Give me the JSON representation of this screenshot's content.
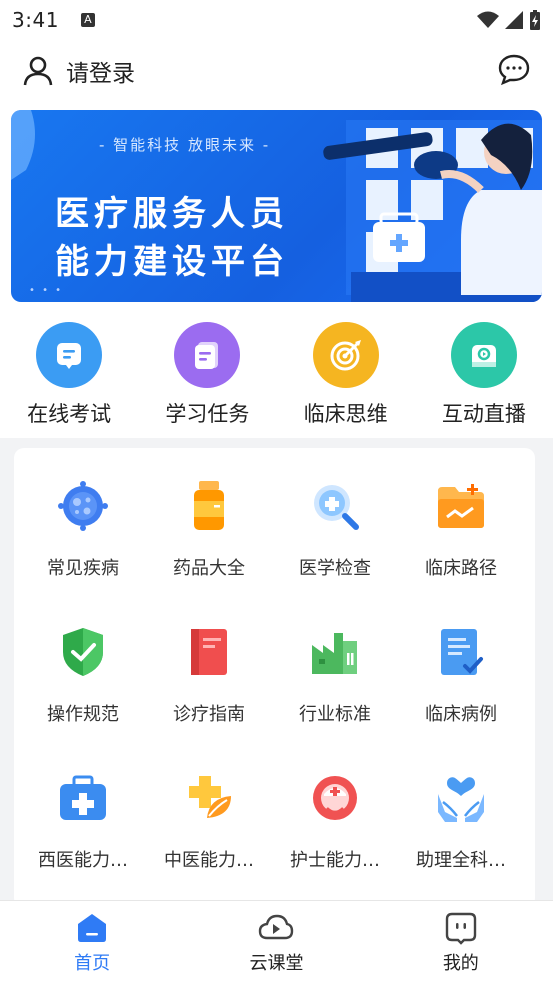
{
  "status_bar": {
    "time": "3:41",
    "icons": [
      "notification-a-icon",
      "wifi-icon",
      "signal-icon",
      "battery-charging-icon"
    ]
  },
  "header": {
    "login_label": "请登录",
    "icons": [
      "user-icon",
      "chat-icon"
    ]
  },
  "banner": {
    "slogan": "- 智能科技 放眼未来 -",
    "title_line1": "医疗服务人员",
    "title_line2": "能力建设平台",
    "indicator": "• • •"
  },
  "quick_menu": [
    {
      "label": "在线考试",
      "icon": "exam-icon",
      "color": "#3b9cf3"
    },
    {
      "label": "学习任务",
      "icon": "task-icon",
      "color": "#9b6cf0"
    },
    {
      "label": "临床思维",
      "icon": "target-icon",
      "color": "#f5b521"
    },
    {
      "label": "互动直播",
      "icon": "live-icon",
      "color": "#2cc7a8"
    }
  ],
  "grid": [
    {
      "label": "常见疾病",
      "icon": "virus-icon"
    },
    {
      "label": "药品大全",
      "icon": "medicine-bottle-icon"
    },
    {
      "label": "医学检查",
      "icon": "magnifier-icon"
    },
    {
      "label": "临床路径",
      "icon": "folder-icon"
    },
    {
      "label": "操作规范",
      "icon": "shield-check-icon"
    },
    {
      "label": "诊疗指南",
      "icon": "guide-book-icon"
    },
    {
      "label": "行业标准",
      "icon": "factory-icon"
    },
    {
      "label": "临床病例",
      "icon": "document-check-icon"
    },
    {
      "label": "西医能力…",
      "icon": "medical-kit-icon"
    },
    {
      "label": "中医能力…",
      "icon": "herb-icon"
    },
    {
      "label": "护士能力…",
      "icon": "nurse-icon"
    },
    {
      "label": "助理全科…",
      "icon": "care-hands-icon"
    }
  ],
  "bottom_nav": [
    {
      "label": "首页",
      "icon": "home-icon",
      "active": true
    },
    {
      "label": "云课堂",
      "icon": "cloud-play-icon",
      "active": false
    },
    {
      "label": "我的",
      "icon": "profile-face-icon",
      "active": false
    }
  ],
  "colors": {
    "accent": "#2f7bf5",
    "banner_bg": "#1668ee"
  }
}
